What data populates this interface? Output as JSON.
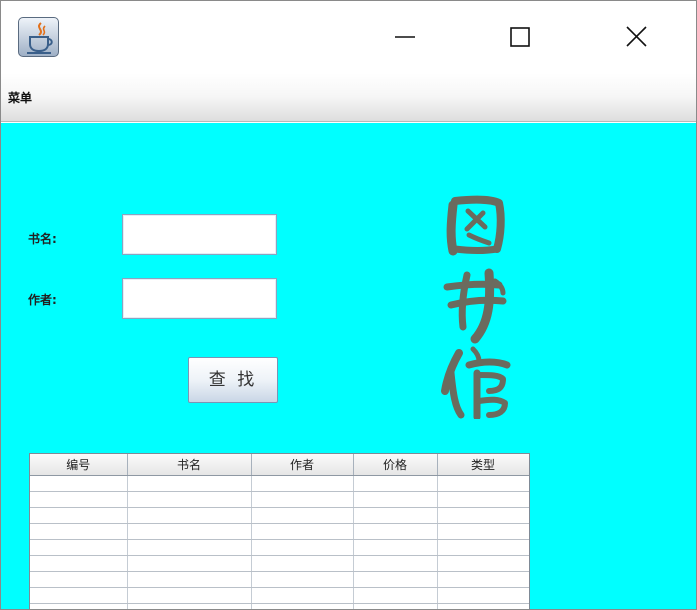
{
  "window": {
    "menu": "菜单",
    "icon": "java-coffee-cup-icon",
    "controls": [
      "minimize-icon",
      "maximize-icon",
      "close-icon"
    ]
  },
  "form": {
    "book_name_label": "书名:",
    "author_label": "作者:",
    "book_name_value": "",
    "author_value": "",
    "search_label": "查 找"
  },
  "banner": {
    "text": "图书馆"
  },
  "table": {
    "columns": [
      "编号",
      "书名",
      "作者",
      "价格",
      "类型"
    ],
    "rows": [
      [
        "",
        "",
        "",
        "",
        ""
      ],
      [
        "",
        "",
        "",
        "",
        ""
      ],
      [
        "",
        "",
        "",
        "",
        ""
      ],
      [
        "",
        "",
        "",
        "",
        ""
      ],
      [
        "",
        "",
        "",
        "",
        ""
      ],
      [
        "",
        "",
        "",
        "",
        ""
      ],
      [
        "",
        "",
        "",
        "",
        ""
      ],
      [
        "",
        "",
        "",
        "",
        ""
      ],
      [
        "",
        "",
        "",
        "",
        ""
      ]
    ]
  },
  "colors": {
    "content_background": "#00ffff",
    "banner_ink": "#6b6b5e"
  }
}
